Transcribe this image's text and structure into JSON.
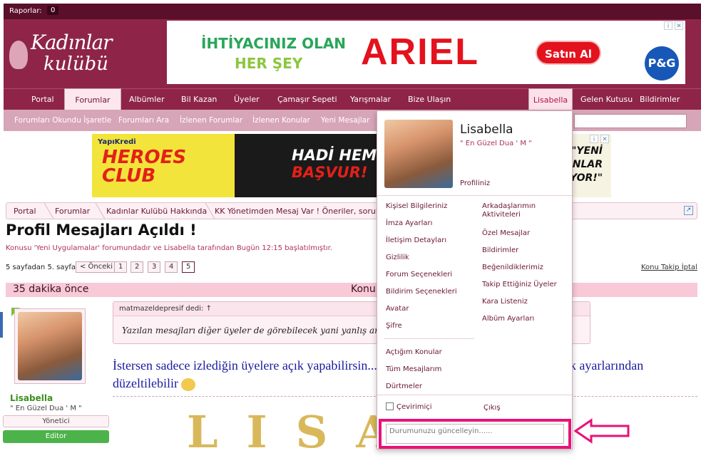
{
  "topbar": {
    "reports_label": "Raporlar:",
    "reports_count": "0"
  },
  "logo": {
    "line1": "Kadınlar",
    "line2": "kulübü"
  },
  "ad_top": {
    "line1": "İHTİYACINIZ OLAN",
    "line2": "HER ŞEY",
    "brand": "ARIEL",
    "button": "Satın Al",
    "sponsor": "P&G"
  },
  "nav": {
    "items": [
      "Portal",
      "Forumlar",
      "Albümler",
      "Bil Kazan",
      "Üyeler",
      "Çamaşır Sepeti",
      "Yarışmalar",
      "Bize Ulaşın"
    ],
    "user": "Lisabella",
    "right": [
      "Gelen Kutusu",
      "Bildirimler"
    ]
  },
  "subnav": {
    "items": [
      "Forumları Okundu İşaretle",
      "Forumları Ara",
      "İzlenen Forumlar",
      "İzlenen Konular",
      "Yeni Mesajlar"
    ]
  },
  "ad_mid": {
    "bank": "YapıKredi",
    "hero1": "HEROES",
    "hero2": "CLUB",
    "cta1": "HADİ HEMEN",
    "cta2": "BAŞVUR!",
    "right1": "\"YENİ",
    "right2": "KANLAR",
    "right3": "...IYOR!\""
  },
  "breadcrumb": [
    "Portal",
    "Forumlar",
    "Kadınlar Kulübü Hakkında",
    "KK Yönetimden Mesaj Var ! Öneriler, sorular ?"
  ],
  "thread": {
    "title": "Profil Mesajları Açıldı !",
    "meta": "Konusu 'Yeni Uygulamalar' forumundadır ve Lisabella tarafından Bugün 12:15 başlatılmıştır."
  },
  "pager": {
    "label": "5 sayfadan 5. sayfa",
    "prev": "< Önceki",
    "pages": [
      "1",
      "2",
      "3",
      "4",
      "5"
    ],
    "follow": "Konu Takip İptal"
  },
  "post": {
    "time": "35 dakika önce",
    "header_right": "Konu",
    "quote_author": "matmazeldepresif dedi: ↑",
    "quote_text": "Yazılan mesajları diğer üyeler de görebilecek yani yanlış anlamad",
    "body_line1": "İstersen sadece izlediğin üyelere açık yapabilirsin...",
    "body_line1_end": "...gizlilik ayarlarından",
    "body_line2": "düzeltilebilir",
    "signature": "LISA"
  },
  "poster": {
    "name": "Lisabella",
    "title": "\" En Güzel Dua ' M \"",
    "role": "Yönetici",
    "badge": "Editor"
  },
  "dropdown": {
    "name": "Lisabella",
    "motto": "\" En Güzel Dua ' M \"",
    "profile_link": "Profiliniz",
    "left_links": [
      "Kişisel Bilgileriniz",
      "İmza Ayarları",
      "İletişim Detayları",
      "Gizlilik",
      "Forum Seçenekleri",
      "Bildirim Seçenekleri",
      "Avatar",
      "Şifre"
    ],
    "right_links": [
      "Arkadaşlarımın Aktiviteleri",
      "Özel Mesajlar",
      "Bildirimler",
      "Beğenildiklerimiz",
      "Takip Ettiğiniz Üyeler",
      "Kara Listeniz",
      "Albüm Ayarları"
    ],
    "bottom_links": [
      "Açtığım Konular",
      "Tüm Mesajlarım",
      "Dürtmeler"
    ],
    "online_label": "Çevirimiçi",
    "logout_label": "Çıkış",
    "status_placeholder": "Durumunuzu güncelleyin......"
  },
  "colors": {
    "brand": "#8e2548",
    "accent": "#e8127a",
    "link": "#6b1535"
  }
}
